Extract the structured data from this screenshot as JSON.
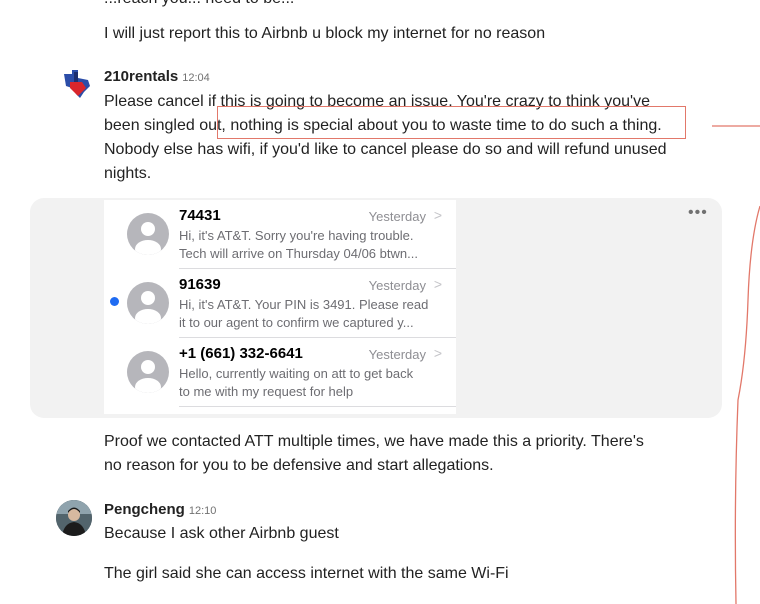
{
  "thread": {
    "partial_top": "...reach you... need to be...",
    "first_message": "I will just report this to Airbnb u block my internet for no reason"
  },
  "host_message": {
    "sender": "210rentals",
    "time": "12:04",
    "lines": [
      "Please cancel if this is going to become an issue. You're crazy to think you've",
      "been singled out, nothing is special about you to waste time to do such a thing.",
      "Nobody else has wifi, if you'd like to cancel please do so and will refund unused",
      "nights."
    ],
    "attachment_menu_label": "•••",
    "proof_lines": [
      "Proof we contacted ATT multiple times, we have made this a priority. There's",
      "no reason for you to be defensive and start allegations."
    ]
  },
  "sms_list": [
    {
      "from": "74431",
      "when": "Yesterday",
      "chevron": ">",
      "preview1": "Hi, it's AT&T. Sorry you're having trouble.",
      "preview2": "Tech will arrive on Thursday 04/06 btwn...",
      "unread": false
    },
    {
      "from": "91639",
      "when": "Yesterday",
      "chevron": ">",
      "preview1": "Hi, it's AT&T. Your PIN is 3491. Please read",
      "preview2": "it to our agent to confirm we captured y...",
      "unread": true
    },
    {
      "from": "+1 (661) 332-6641",
      "when": "Yesterday",
      "chevron": ">",
      "preview1": "Hello, currently waiting on att to get back",
      "preview2": "to me with my request for help",
      "unread": false
    }
  ],
  "guest_message": {
    "sender": "Pengcheng",
    "time": "12:10",
    "line1": "Because I ask other Airbnb guest",
    "line2": "The girl said she can access internet with the same Wi-Fi"
  },
  "colors": {
    "annotation": "#e2786a",
    "unread_dot": "#1f6bf2",
    "text": "#222222",
    "muted": "#717171"
  }
}
